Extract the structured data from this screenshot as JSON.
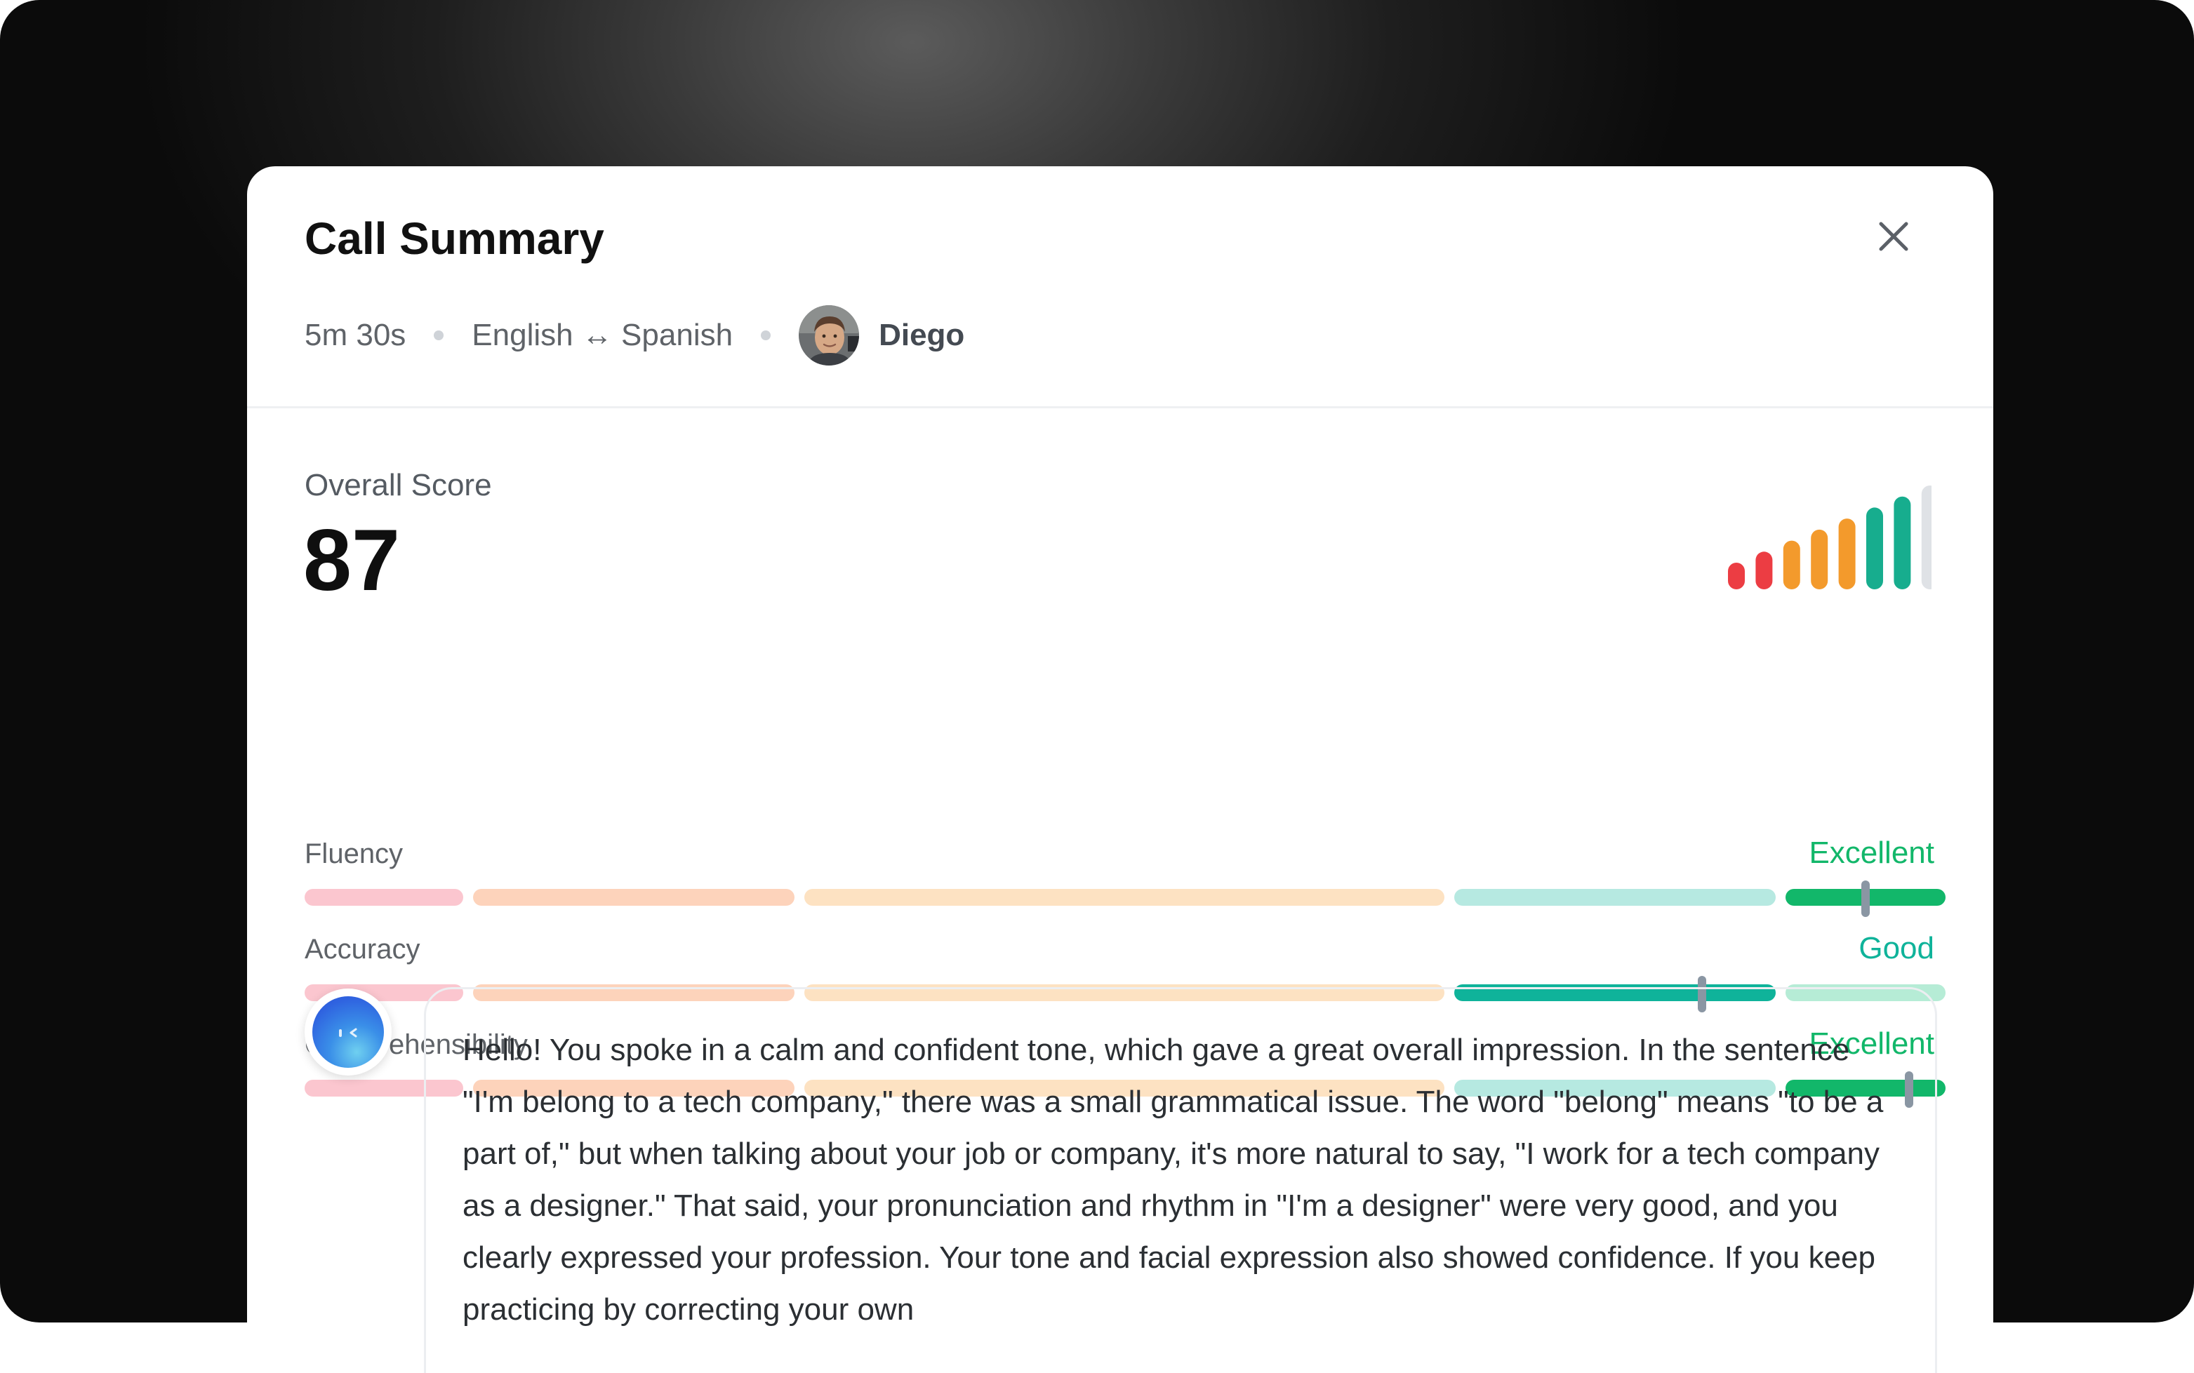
{
  "modal": {
    "title": "Call Summary",
    "close_icon": "close-icon"
  },
  "meta": {
    "duration": "5m 30s",
    "languages": "English ↔ Spanish",
    "user_name": "Diego"
  },
  "score": {
    "label": "Overall Score",
    "value": "87",
    "level_bars_filled": 7,
    "level_bars_total": 8
  },
  "metrics": [
    {
      "name": "Fluency",
      "rating": "Excellent",
      "rating_color": "#12b76a",
      "active_segment": 4,
      "marker_fraction": 0.5
    },
    {
      "name": "Accuracy",
      "rating": "Good",
      "rating_color": "#0fb39a",
      "active_segment": 3,
      "marker_fraction": 0.77
    },
    {
      "name": "Comprehensibility",
      "rating": "Excellent",
      "rating_color": "#12b76a",
      "active_segment": 4,
      "marker_fraction": 0.77
    }
  ],
  "feedback": {
    "text": "Hello! You spoke in a calm and confident tone, which gave a great overall impression. In the sentence \"I'm belong to a tech company,\" there was a small grammatical issue. The word \"belong\" means \"to be a part of,\" but when talking about your job or company, it's more natural to say, \"I work for a tech company as a designer.\" That said, your pronunciation and rhythm in \"I'm a designer\" were very good, and you clearly expressed your profession. Your tone and facial expression also showed confidence. If you keep practicing by correcting your own"
  },
  "colors": {
    "segment_pale": [
      "#fbc6cf",
      "#fdd3bb",
      "#fde2c2",
      "#b6e9e1",
      "#b6ecd6"
    ],
    "segment_active": [
      "#f2657a",
      "#f59e67",
      "#f6b13f",
      "#0fb39a",
      "#12b76a"
    ],
    "score_bars": [
      "#ec3d43",
      "#ec3d43",
      "#f39a2c",
      "#f39a2c",
      "#f39a2c",
      "#17ad8e",
      "#17ad8e",
      "#dfe2e6"
    ]
  }
}
